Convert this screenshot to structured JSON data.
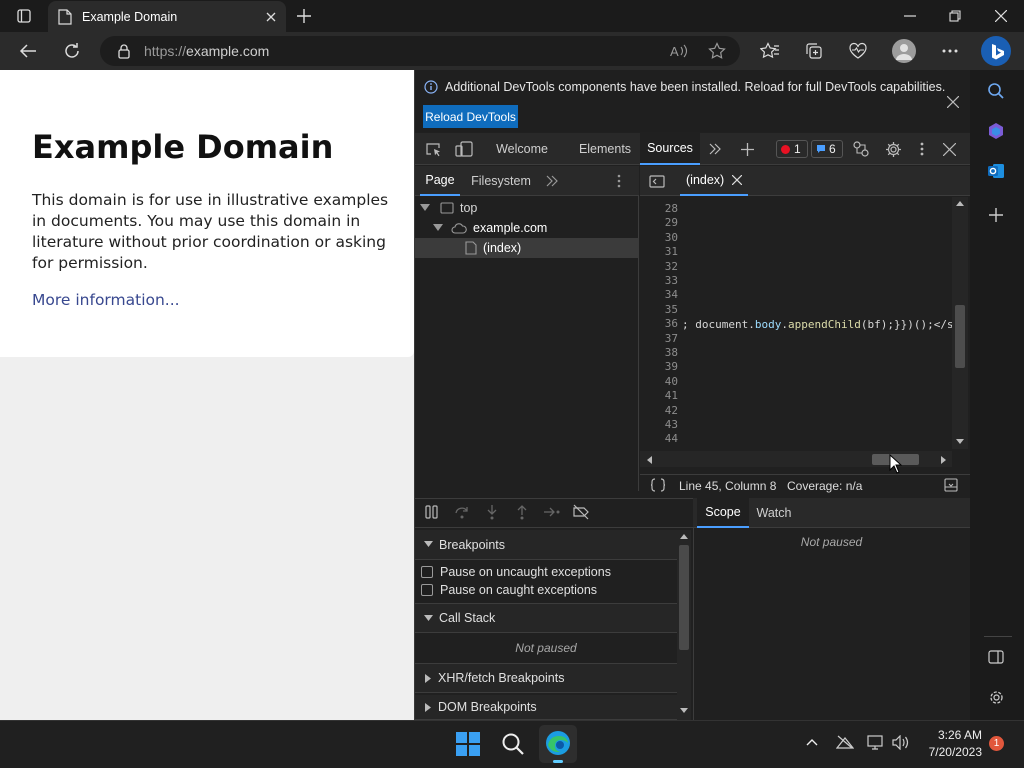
{
  "browser": {
    "tab_title": "Example Domain",
    "url_protocol": "https://",
    "url_host": "example.com"
  },
  "page": {
    "heading": "Example Domain",
    "paragraph": "This domain is for use in illustrative examples in documents. You may use this domain in literature without prior coordination or asking for permission.",
    "link": "More information..."
  },
  "devtools": {
    "info_message": "Additional DevTools components have been installed. Reload for full DevTools capabilities.",
    "reload_button": "Reload DevTools",
    "tabs": [
      "Welcome",
      "Elements",
      "Sources"
    ],
    "active_tab": "Sources",
    "error_count": "1",
    "message_count": "6",
    "navigator_tabs": [
      "Page",
      "Filesystem"
    ],
    "tree": {
      "top": "top",
      "domain": "example.com",
      "file": "(index)"
    },
    "editor_tab": "(index)",
    "line_numbers": [
      "28",
      "29",
      "30",
      "31",
      "32",
      "33",
      "34",
      "35",
      "36",
      "37",
      "38",
      "39",
      "40",
      "41",
      "42",
      "43",
      "44"
    ],
    "code_line_36": "; document.body.appendChild(bf);}})();</s",
    "status_position": "Line 45, Column 8",
    "status_coverage": "Coverage: n/a",
    "debugger": {
      "breakpoints_header": "Breakpoints",
      "pause_uncaught": "Pause on uncaught exceptions",
      "pause_caught": "Pause on caught exceptions",
      "callstack_header": "Call Stack",
      "callstack_status": "Not paused",
      "xhr_header": "XHR/fetch Breakpoints",
      "dom_header": "DOM Breakpoints",
      "scope_tab": "Scope",
      "watch_tab": "Watch",
      "scope_status": "Not paused"
    }
  },
  "taskbar": {
    "time": "3:26 AM",
    "date": "7/20/2023",
    "notification_count": "1"
  },
  "colors": {
    "accent": "#0f6cbd",
    "active_tab_underline": "#4a9eff",
    "error_badge": "#e81123",
    "page_link": "#38488f"
  }
}
